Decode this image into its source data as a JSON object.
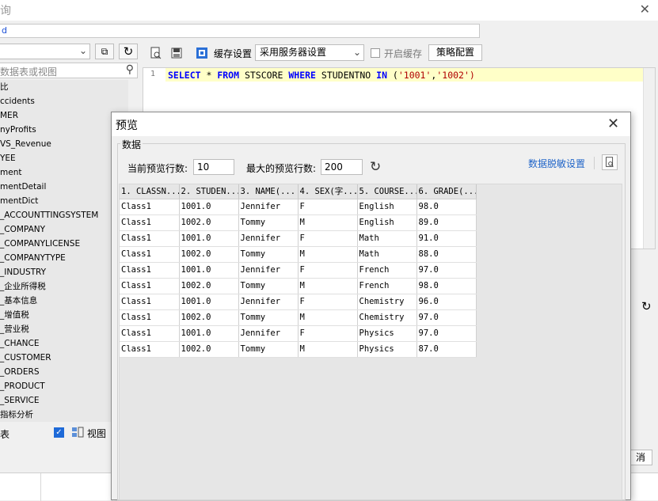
{
  "window": {
    "title_fragment": "询",
    "name_value": "d"
  },
  "left": {
    "search_placeholder": "数据表或视图",
    "tree_items": [
      "比",
      "ccidents",
      "MER",
      "nyProfits",
      "VS_Revenue",
      "YEE",
      "ment",
      "mentDetail",
      "mentDict",
      "_ACCOUNTTINGSYSTEM",
      "_COMPANY",
      "_COMPANYLICENSE",
      "_COMPANYTYPE",
      "_INDUSTRY",
      "_企业所得税",
      "_基本信息",
      "_增值税",
      "_营业税",
      "_CHANCE",
      "_CUSTOMER",
      "_ORDERS",
      "_PRODUCT",
      "_SERVICE",
      "指标分析"
    ],
    "bottom_label_fragment": "表",
    "view_checked": true,
    "view_label": "视图"
  },
  "toolbar": {
    "cache_label": "缓存设置",
    "cache_select": "采用服务器设置",
    "enable_cache_label": "开启缓存",
    "strategy_button": "策略配置"
  },
  "editor": {
    "line_number": "1",
    "sql_tokens": [
      {
        "t": "SELECT",
        "k": "kw"
      },
      {
        "t": " * ",
        "k": "plain"
      },
      {
        "t": "FROM",
        "k": "kw"
      },
      {
        "t": " STSCORE ",
        "k": "plain"
      },
      {
        "t": "WHERE",
        "k": "kw"
      },
      {
        "t": " STUDENTNO ",
        "k": "plain"
      },
      {
        "t": "IN",
        "k": "kw"
      },
      {
        "t": " (",
        "k": "plain"
      },
      {
        "t": "'1001'",
        "k": "str"
      },
      {
        "t": ",",
        "k": "plain"
      },
      {
        "t": "'1002'",
        "k": "str"
      },
      {
        "t": ")",
        "k": "str"
      }
    ]
  },
  "right": {
    "cancel_fragment": "消"
  },
  "dialog": {
    "title": "预览",
    "group_label": "数据",
    "current_rows_label": "当前预览行数:",
    "current_rows_value": "10",
    "max_rows_label": "最大的预览行数:",
    "max_rows_value": "200",
    "mask_link": "数据脱敏设置",
    "columns": [
      "1. CLASSN...",
      "2. STUDEN...",
      "3. NAME(...",
      "4. SEX(字...",
      "5. COURSE...",
      "6. GRADE(..."
    ],
    "rows": [
      [
        "Class1",
        "1001.0",
        "Jennifer",
        "F",
        "English",
        "98.0"
      ],
      [
        "Class1",
        "1002.0",
        "Tommy",
        "M",
        "English",
        "89.0"
      ],
      [
        "Class1",
        "1001.0",
        "Jennifer",
        "F",
        "Math",
        "91.0"
      ],
      [
        "Class1",
        "1002.0",
        "Tommy",
        "M",
        "Math",
        "88.0"
      ],
      [
        "Class1",
        "1001.0",
        "Jennifer",
        "F",
        "French",
        "97.0"
      ],
      [
        "Class1",
        "1002.0",
        "Tommy",
        "M",
        "French",
        "98.0"
      ],
      [
        "Class1",
        "1001.0",
        "Jennifer",
        "F",
        "Chemistry",
        "96.0"
      ],
      [
        "Class1",
        "1002.0",
        "Tommy",
        "M",
        "Chemistry",
        "97.0"
      ],
      [
        "Class1",
        "1001.0",
        "Jennifer",
        "F",
        "Physics",
        "97.0"
      ],
      [
        "Class1",
        "1002.0",
        "Tommy",
        "M",
        "Physics",
        "87.0"
      ]
    ]
  }
}
